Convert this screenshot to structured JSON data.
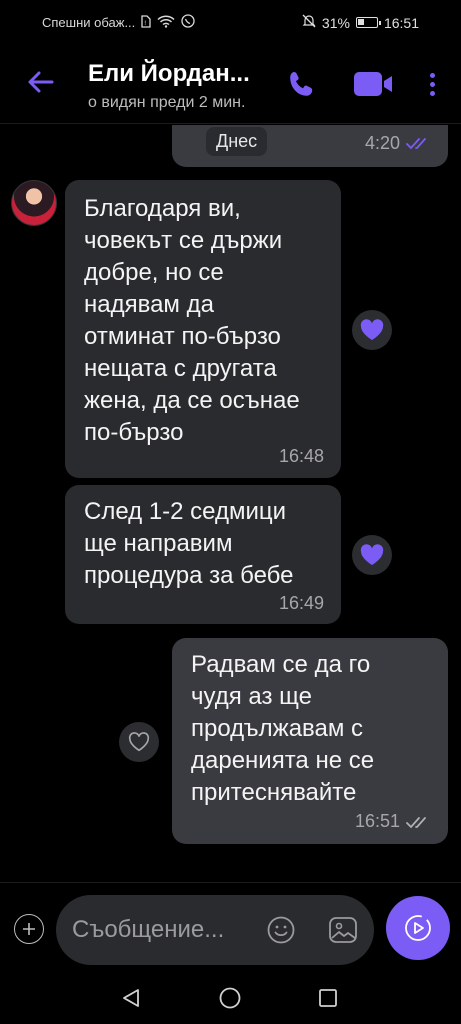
{
  "status_bar": {
    "left_text": "Спешни обаж...",
    "battery": "31%",
    "battery_level": 0.31,
    "time": "16:51"
  },
  "header": {
    "contact_name": "Ели Йордан...",
    "contact_status": "о видян преди 2 мин.",
    "accent_color": "#7b5cf5"
  },
  "messages": [
    {
      "direction": "outgoing",
      "text": "Днес",
      "time": "4:20",
      "read": true
    },
    {
      "direction": "incoming",
      "text": "Благодаря ви,\nчовекът се държи\nдобре, но се\nнадявам да\nотминат по-бързо\nнещата с другата\nжена, да се осънае\nпо-бързо",
      "time": "16:48",
      "reaction": "heart-filled"
    },
    {
      "direction": "incoming",
      "text": "След 1-2 седмици\nще направим\nпроцедура за бебе",
      "time": "16:49",
      "reaction": "heart-filled"
    },
    {
      "direction": "outgoing",
      "text": "Радвам се да го\nчудя аз ще\nпродължавам с\nдаренията не се\nпритеснявайте",
      "time": "16:51",
      "read": true,
      "reaction": "heart-outline"
    }
  ],
  "input": {
    "placeholder": "Съобщение..."
  },
  "icons": {
    "back": "back-arrow-icon",
    "call": "phone-icon",
    "video": "video-camera-icon",
    "more": "more-vertical-icon",
    "add": "plus-icon",
    "emoji": "emoji-icon",
    "gallery": "image-icon",
    "send": "send-icon"
  }
}
